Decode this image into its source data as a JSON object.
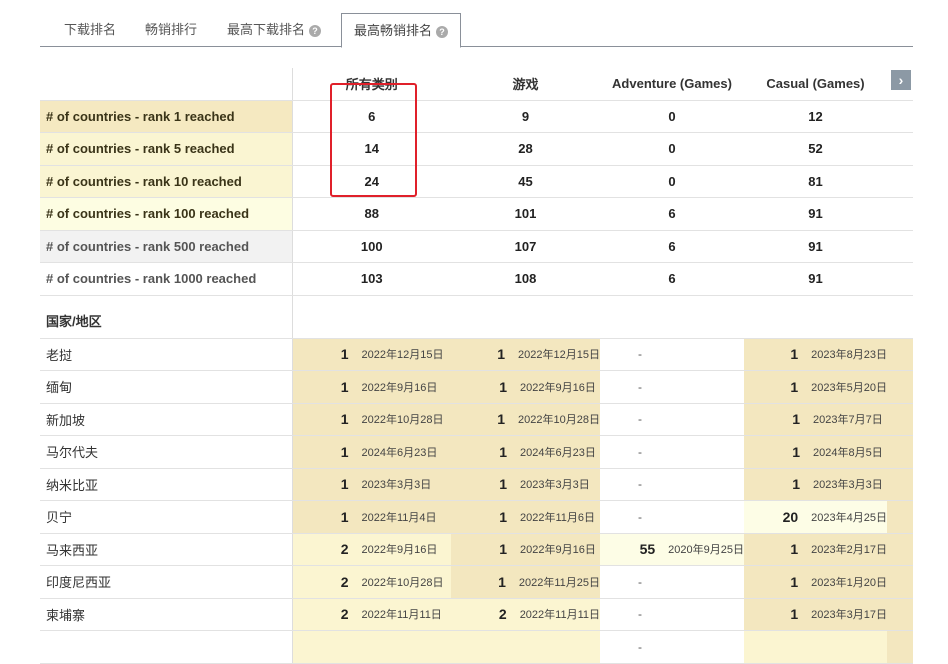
{
  "tabs": [
    {
      "label": "下载排名",
      "help": false
    },
    {
      "label": "畅销排行",
      "help": false
    },
    {
      "label": "最高下载排名",
      "help": true
    },
    {
      "label": "最高畅销排名",
      "help": true,
      "active": true
    }
  ],
  "help_glyph": "?",
  "next_glyph": "›",
  "columns": [
    "所有类别",
    "游戏",
    "Adventure (Games)",
    "Casual (Games)"
  ],
  "summary": [
    {
      "label": "# of countries - rank 1 reached",
      "values": [
        "6",
        "9",
        "0",
        "12"
      ],
      "bg": "#f5e9c1",
      "bold": true
    },
    {
      "label": "# of countries - rank 5 reached",
      "values": [
        "14",
        "28",
        "0",
        "52"
      ],
      "bg": "#faf5d2",
      "bold": true
    },
    {
      "label": "# of countries - rank 10 reached",
      "values": [
        "24",
        "45",
        "0",
        "81"
      ],
      "bg": "#faf5d2",
      "bold": true
    },
    {
      "label": "# of countries - rank 100 reached",
      "values": [
        "88",
        "101",
        "6",
        "91"
      ],
      "bg": "#fdfde2",
      "bold": false
    },
    {
      "label": "# of countries - rank 500 reached",
      "values": [
        "100",
        "107",
        "6",
        "91"
      ],
      "bg": "#f2f2f2",
      "bold": true
    },
    {
      "label": "# of countries - rank 1000 reached",
      "values": [
        "103",
        "108",
        "6",
        "91"
      ],
      "bg": "#ffffff",
      "bold": true
    }
  ],
  "section_label": "国家/地区",
  "tier_colors": {
    "top1": "#f3e7bf",
    "top10": "#fbf5d1",
    "top100": "#fdfde6",
    "none": "#ffffff"
  },
  "countries": [
    {
      "name": "老挝",
      "cells": [
        [
          "1",
          "2022年12月15日"
        ],
        [
          "1",
          "2022年12月15日"
        ],
        [
          "-",
          ""
        ],
        [
          "1",
          "2023年8月23日"
        ]
      ]
    },
    {
      "name": "缅甸",
      "cells": [
        [
          "1",
          "2022年9月16日"
        ],
        [
          "1",
          "2022年9月16日"
        ],
        [
          "-",
          ""
        ],
        [
          "1",
          "2023年5月20日"
        ]
      ]
    },
    {
      "name": "新加坡",
      "cells": [
        [
          "1",
          "2022年10月28日"
        ],
        [
          "1",
          "2022年10月28日"
        ],
        [
          "-",
          ""
        ],
        [
          "1",
          "2023年7月7日"
        ]
      ]
    },
    {
      "name": "马尔代夫",
      "cells": [
        [
          "1",
          "2024年6月23日"
        ],
        [
          "1",
          "2024年6月23日"
        ],
        [
          "-",
          ""
        ],
        [
          "1",
          "2024年8月5日"
        ]
      ]
    },
    {
      "name": "纳米比亚",
      "cells": [
        [
          "1",
          "2023年3月3日"
        ],
        [
          "1",
          "2023年3月3日"
        ],
        [
          "-",
          ""
        ],
        [
          "1",
          "2023年3月3日"
        ]
      ]
    },
    {
      "name": "贝宁",
      "cells": [
        [
          "1",
          "2022年11月4日"
        ],
        [
          "1",
          "2022年11月6日"
        ],
        [
          "-",
          ""
        ],
        [
          "20",
          "2023年4月25日"
        ]
      ]
    },
    {
      "name": "马来西亚",
      "cells": [
        [
          "2",
          "2022年9月16日"
        ],
        [
          "1",
          "2022年9月16日"
        ],
        [
          "55",
          "2020年9月25日"
        ],
        [
          "1",
          "2023年2月17日"
        ]
      ]
    },
    {
      "name": "印度尼西亚",
      "cells": [
        [
          "2",
          "2022年10月28日"
        ],
        [
          "1",
          "2022年11月25日"
        ],
        [
          "-",
          ""
        ],
        [
          "1",
          "2023年1月20日"
        ]
      ]
    },
    {
      "name": "柬埔寨",
      "cells": [
        [
          "2",
          "2022年11月11日"
        ],
        [
          "2",
          "2022年11月11日"
        ],
        [
          "-",
          ""
        ],
        [
          "1",
          "2023年3月17日"
        ]
      ]
    },
    {
      "name": "",
      "cells": [
        [
          "",
          ""
        ],
        [
          "",
          ""
        ],
        [
          "-",
          ""
        ],
        [
          "",
          ""
        ]
      ]
    }
  ]
}
